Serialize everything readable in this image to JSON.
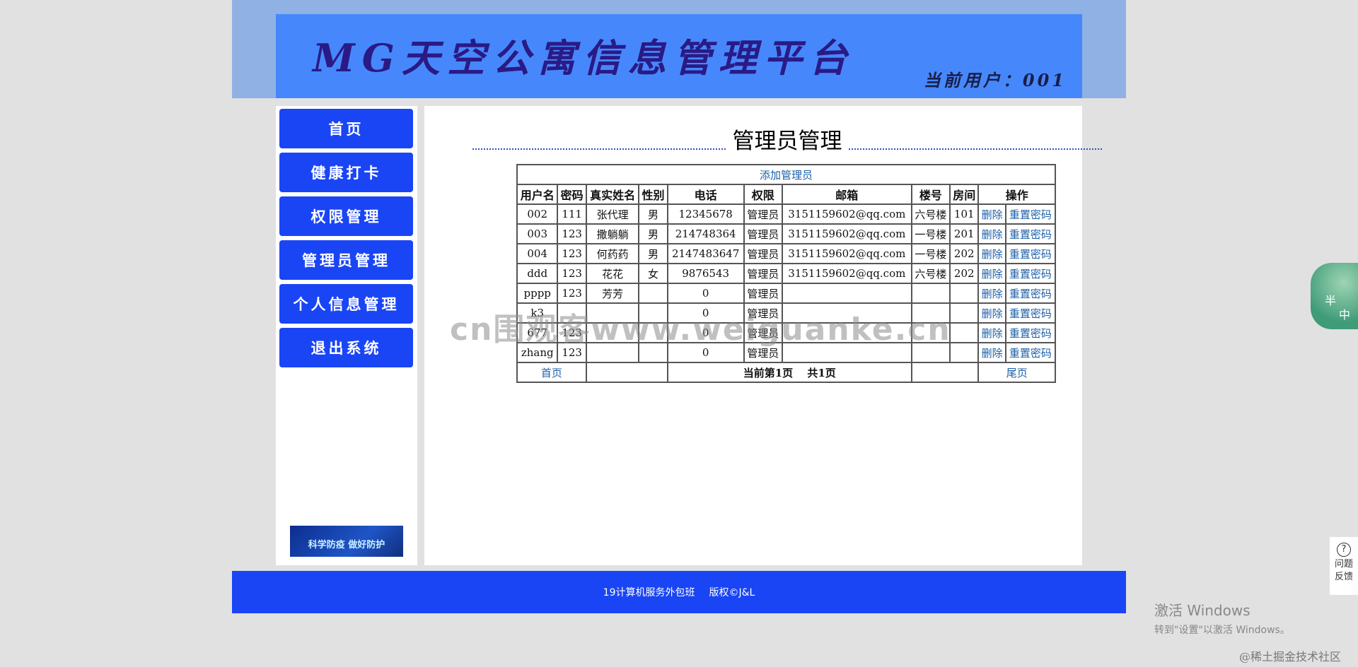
{
  "header": {
    "title": "MG天空公寓信息管理平台",
    "current_user": "当前用户：001"
  },
  "sidebar": {
    "items": [
      {
        "label": "首页"
      },
      {
        "label": "健康打卡"
      },
      {
        "label": "权限管理"
      },
      {
        "label": "管理员管理"
      },
      {
        "label": "个人信息管理"
      },
      {
        "label": "退出系统"
      }
    ],
    "banner_text": "科学防疫 做好防护"
  },
  "main": {
    "page_title": "管理员管理",
    "add_link": "添加管理员",
    "columns": [
      "用户名",
      "密码",
      "真实姓名",
      "性别",
      "电话",
      "权限",
      "邮箱",
      "楼号",
      "房间",
      "操作"
    ],
    "rows": [
      {
        "username": "002",
        "password": "111",
        "realname": "张代理",
        "gender": "男",
        "phone": "12345678",
        "role": "管理员",
        "email": "3151159602@qq.com",
        "building": "六号楼",
        "room": "101"
      },
      {
        "username": "003",
        "password": "123",
        "realname": "撒躺躺",
        "gender": "男",
        "phone": "214748364",
        "role": "管理员",
        "email": "3151159602@qq.com",
        "building": "一号楼",
        "room": "201"
      },
      {
        "username": "004",
        "password": "123",
        "realname": "何药药",
        "gender": "男",
        "phone": "2147483647",
        "role": "管理员",
        "email": "3151159602@qq.com",
        "building": "一号楼",
        "room": "202"
      },
      {
        "username": "ddd",
        "password": "123",
        "realname": "花花",
        "gender": "女",
        "phone": "9876543",
        "role": "管理员",
        "email": "3151159602@qq.com",
        "building": "六号楼",
        "room": "202"
      },
      {
        "username": "pppp",
        "password": "123",
        "realname": "芳芳",
        "gender": "",
        "phone": "0",
        "role": "管理员",
        "email": "",
        "building": "",
        "room": ""
      },
      {
        "username": "k3",
        "password": "",
        "realname": "",
        "gender": "",
        "phone": "0",
        "role": "管理员",
        "email": "",
        "building": "",
        "room": ""
      },
      {
        "username": "677",
        "password": "123",
        "realname": "",
        "gender": "",
        "phone": "0",
        "role": "管理员",
        "email": "",
        "building": "",
        "room": ""
      },
      {
        "username": "zhang",
        "password": "123",
        "realname": "",
        "gender": "",
        "phone": "0",
        "role": "管理员",
        "email": "",
        "building": "",
        "room": ""
      }
    ],
    "delete_label": "删除",
    "reset_label": "重置密码",
    "pager": {
      "first": "首页",
      "status": "当前第1页　 共1页",
      "last": "尾页"
    }
  },
  "footer": {
    "class_name": "19计算机服务外包班",
    "copyright": "版权©J&L"
  },
  "overlay": {
    "watermark": "cn围观客www.weiguanke.cn",
    "widget_top": "半",
    "widget_bottom": "中",
    "help_label": "问题反馈",
    "help_icon": "?",
    "activate_title": "激活 Windows",
    "activate_sub": "转到\"设置\"以激活 Windows。",
    "community": "@稀土掘金技术社区"
  }
}
